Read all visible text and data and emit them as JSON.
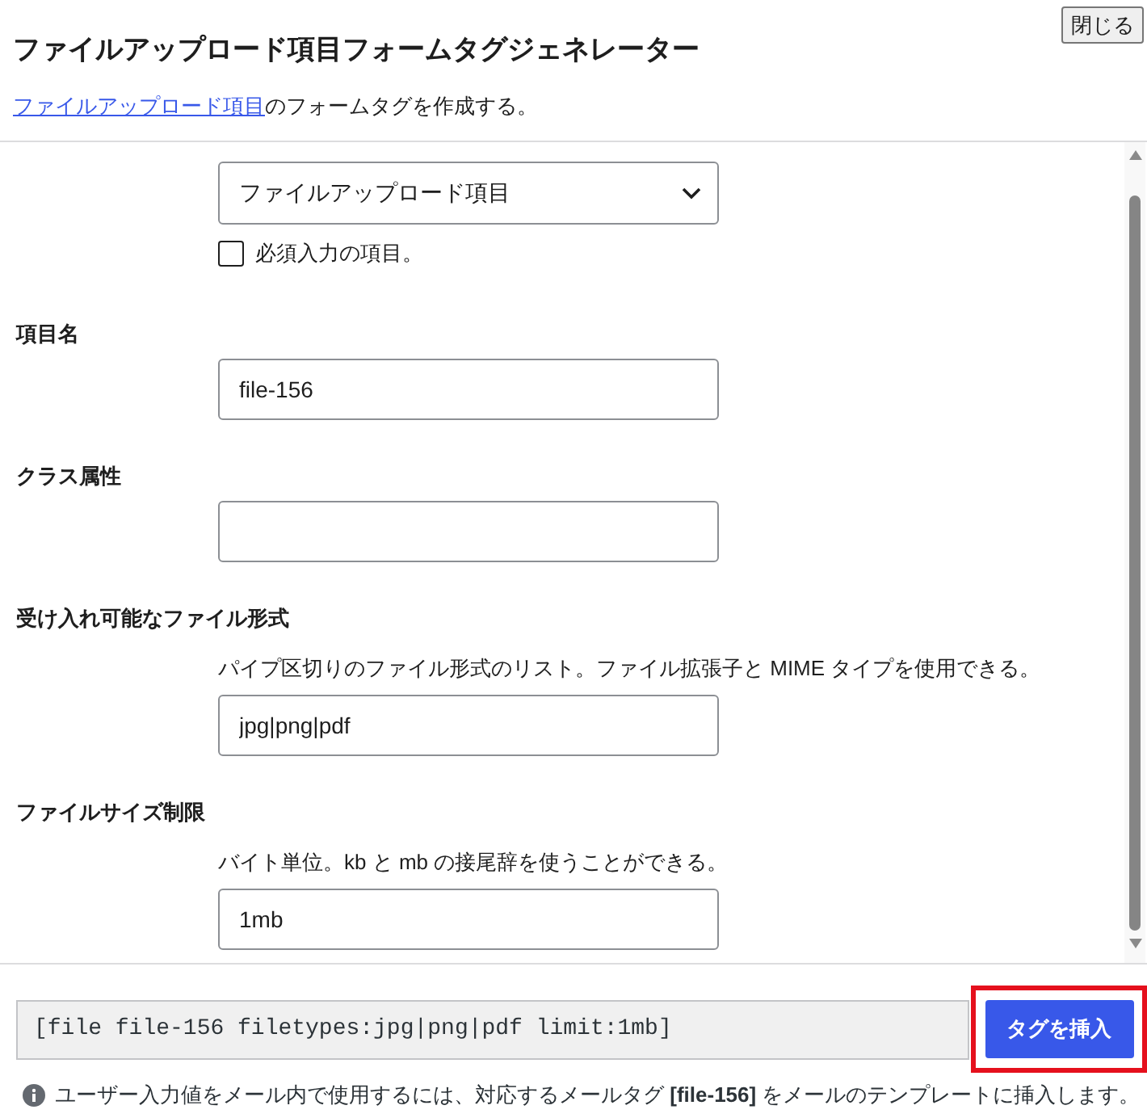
{
  "close_button": {
    "label": "閉じる"
  },
  "title": "ファイルアップロード項目フォームタグジェネレーター",
  "intro": {
    "link": "ファイルアップロード項目",
    "text": "のフォームタグを作成する。"
  },
  "field_type": {
    "value": "ファイルアップロード項目",
    "required": {
      "label": "必須入力の項目。",
      "checked": false
    }
  },
  "fields": [
    {
      "label": "項目名",
      "value": "file-156"
    },
    {
      "label": "クラス属性"
    },
    {
      "label": "受け入れ可能なファイル形式",
      "description": "パイプ区切りのファイル形式のリスト。ファイル拡張子と MIME タイプを使用できる。",
      "value": "jpg|png|pdf"
    },
    {
      "label": "ファイルサイズ制限",
      "description": "バイト単位。kb と mb の接尾辞を使うことができる。",
      "value": "1mb"
    }
  ],
  "tag_output": {
    "value": "[file file-156 filetypes:jpg|png|pdf limit:1mb]"
  },
  "insert_button": {
    "label": "タグを挿入",
    "highlighted": true
  },
  "note": "ユーザー入力値をメール内で使用するには、対応するメールタグ **[file-156]** をメールのテンプレートに挿入します。"
}
